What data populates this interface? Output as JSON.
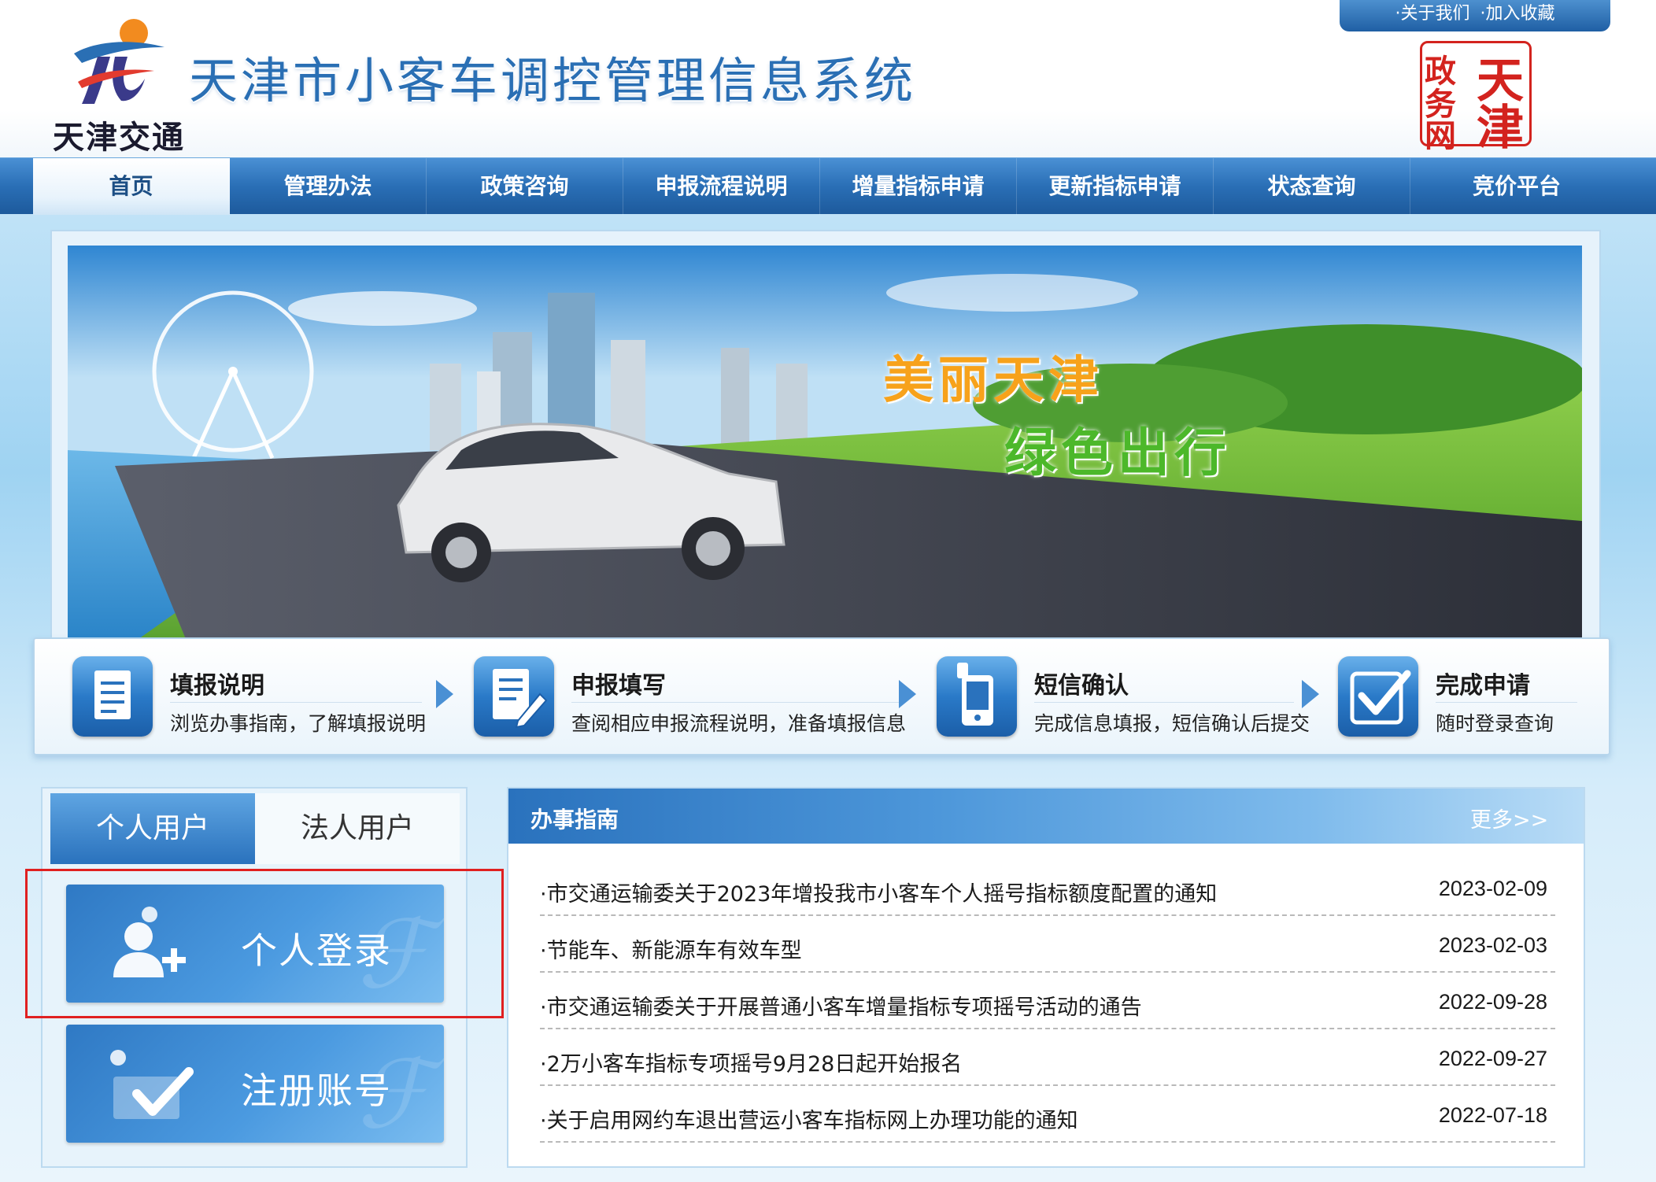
{
  "header": {
    "logo_text": "天津交通",
    "site_title": "天津市小客车调控管理信息系统",
    "top_links": [
      "·关于我们",
      "·加入收藏"
    ],
    "seal_chars": [
      "天",
      "津",
      "政",
      "务",
      "网"
    ]
  },
  "nav": {
    "items": [
      {
        "label": "首页",
        "active": true
      },
      {
        "label": "管理办法",
        "active": false
      },
      {
        "label": "政策咨询",
        "active": false
      },
      {
        "label": "申报流程说明",
        "active": false
      },
      {
        "label": "增量指标申请",
        "active": false
      },
      {
        "label": "更新指标申请",
        "active": false
      },
      {
        "label": "状态查询",
        "active": false
      },
      {
        "label": "竞价平台",
        "active": false
      }
    ]
  },
  "banner": {
    "slogan_1": "美丽天津",
    "slogan_2": "绿色出行"
  },
  "steps": [
    {
      "title": "填报说明",
      "desc": "浏览办事指南，了解填报说明",
      "icon": "document-icon"
    },
    {
      "title": "申报填写",
      "desc": "查阅相应申报流程说明，准备填报信息",
      "icon": "form-edit-icon"
    },
    {
      "title": "短信确认",
      "desc": "完成信息填报，短信确认后提交",
      "icon": "mobile-phone-icon"
    },
    {
      "title": "完成申请",
      "desc": "随时登录查询",
      "icon": "checkmark-icon"
    }
  ],
  "login": {
    "tabs": [
      {
        "label": "个人用户",
        "active": true
      },
      {
        "label": "法人用户",
        "active": false
      }
    ],
    "login_button": "个人登录",
    "register_button": "注册账号"
  },
  "news": {
    "title": "办事指南",
    "more": "更多>>",
    "items": [
      {
        "title": "·市交通运输委关于2023年增投我市小客车个人摇号指标额度配置的通知",
        "date": "2023-02-09"
      },
      {
        "title": "·节能车、新能源车有效车型",
        "date": "2023-02-03"
      },
      {
        "title": "·市交通运输委关于开展普通小客车增量指标专项摇号活动的通告",
        "date": "2022-09-28"
      },
      {
        "title": "·2万小客车指标专项摇号9月28日起开始报名",
        "date": "2022-09-27"
      },
      {
        "title": "·关于启用网约车退出营运小客车指标网上办理功能的通知",
        "date": "2022-07-18"
      }
    ]
  },
  "colors": {
    "primary_blue": "#2a72bd",
    "seal_red": "#d3231e",
    "highlight_red": "#e02020"
  }
}
